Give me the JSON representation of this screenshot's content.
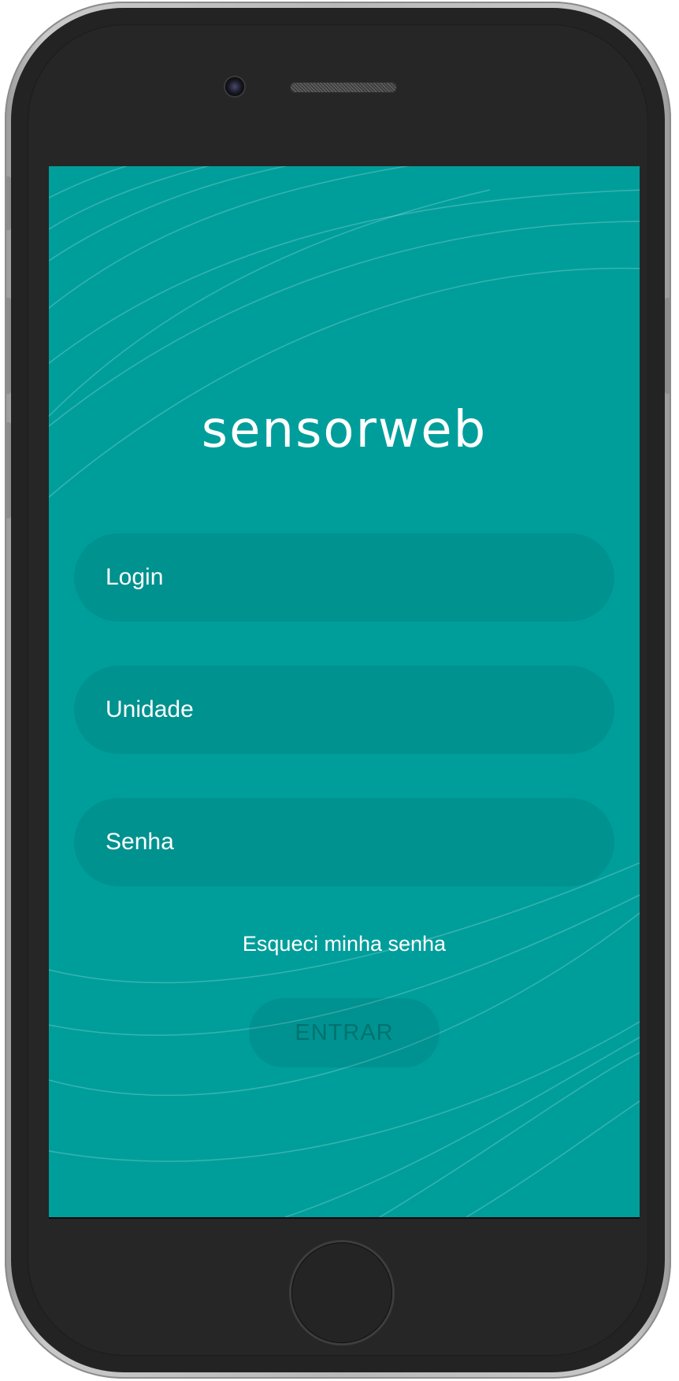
{
  "app": {
    "logo_text": "sensorweb"
  },
  "form": {
    "login_placeholder": "Login",
    "unidade_placeholder": "Unidade",
    "senha_placeholder": "Senha",
    "forgot_password": "Esqueci minha senha",
    "submit_label": "ENTRAR"
  },
  "colors": {
    "screen_background": "#009e9b",
    "text": "#ffffff",
    "device_body": "#232323",
    "device_frame": "#b9b9b9"
  }
}
